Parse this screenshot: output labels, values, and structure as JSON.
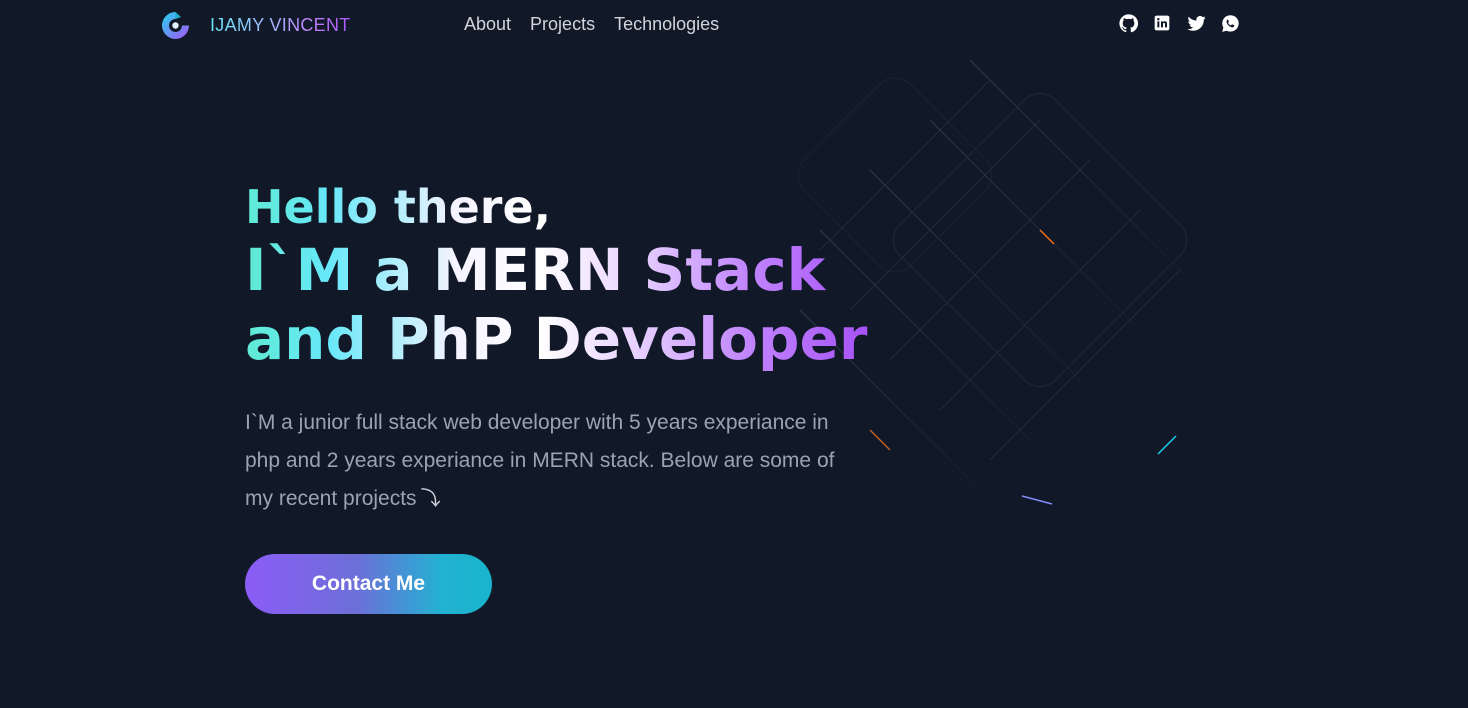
{
  "brand": {
    "name": "IJAMY VINCENT",
    "logo_icon": "spiral-logo-icon"
  },
  "nav": {
    "links": [
      {
        "label": "About"
      },
      {
        "label": "Projects"
      },
      {
        "label": "Technologies"
      }
    ]
  },
  "socials": [
    {
      "icon": "github-icon"
    },
    {
      "icon": "linkedin-icon"
    },
    {
      "icon": "twitter-icon"
    },
    {
      "icon": "whatsapp-icon"
    }
  ],
  "hero": {
    "greeting": "Hello there,",
    "headline_line1": "I`M a MERN Stack",
    "headline_line2": "and PhP Developer",
    "intro": "I`M a junior full stack web developer with 5 years experiance in php and 2 years experiance in MERN stack. Below are some of my recent projects",
    "arrow": "⤵",
    "cta_label": "Contact Me"
  },
  "colors": {
    "background": "#111827",
    "accent_cyan": "#22d3ee",
    "accent_purple": "#a855f7"
  }
}
